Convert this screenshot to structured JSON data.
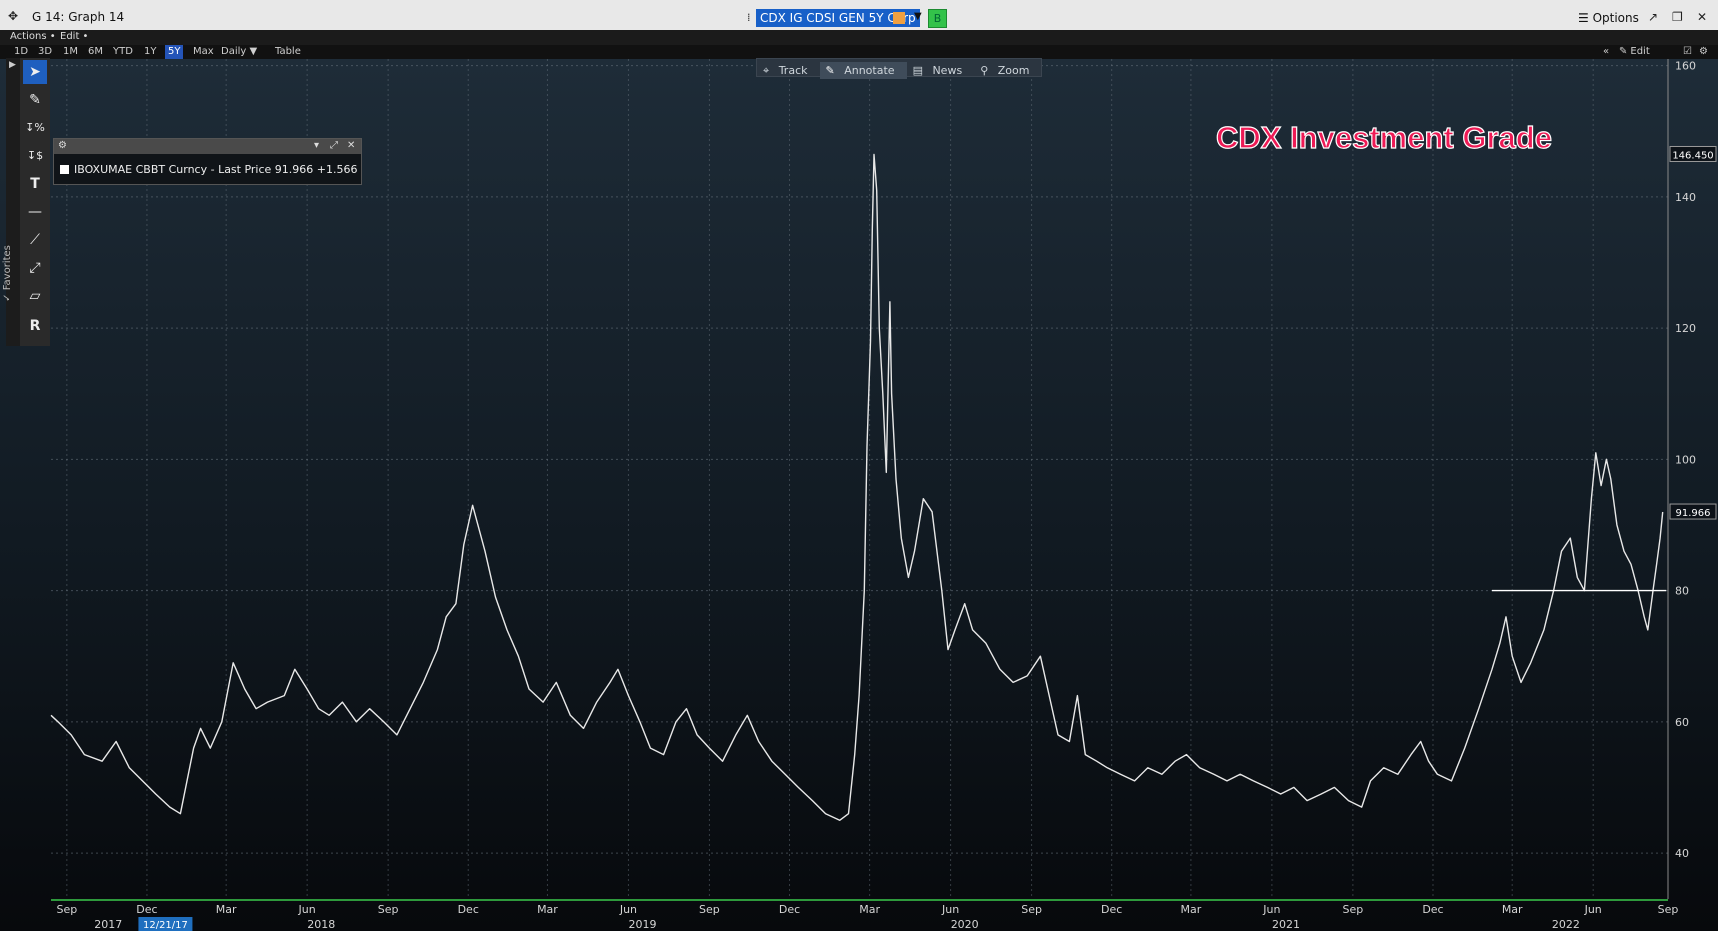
{
  "window": {
    "title": "G 14: Graph 14",
    "ticker": "CDX IG CDSI GEN 5Y Corp",
    "b_label": "B",
    "options_label": "Options",
    "icons": [
      "move-icon",
      "ticker-dropdown-icon",
      "popout-icon",
      "restore-icon",
      "close-icon"
    ]
  },
  "menu": {
    "actions": "Actions •",
    "edit": "Edit •"
  },
  "ranges": {
    "items": [
      "1D",
      "3D",
      "1M",
      "6M",
      "YTD",
      "1Y",
      "5Y",
      "Max"
    ],
    "selected": "5Y",
    "frequency": "Daily ▼",
    "table": "Table",
    "edit_chart": "Edit Chart"
  },
  "controls": [
    "Track",
    "Annotate",
    "News",
    "Zoom"
  ],
  "active_control": "Annotate",
  "favorites_label": "Favorites",
  "tools": [
    "cursor-icon",
    "pencil-icon",
    "percent-icon",
    "dollar-icon",
    "text-icon",
    "horizontal-line-icon",
    "trend-line-icon",
    "ray-line-icon",
    "channel-icon",
    "r-icon"
  ],
  "legend": {
    "text": "IBOXUMAE CBBT Curncy - Last Price 91.966  +1.566"
  },
  "annotation": "CDX Investment Grade",
  "chart_data": {
    "type": "line",
    "title": "",
    "xlabel": "",
    "ylabel": "",
    "ylim": [
      33,
      161
    ],
    "yticks": [
      40,
      60,
      80,
      100,
      120,
      140,
      160
    ],
    "grid": true,
    "y_axis_side": "right",
    "current_value_label": "91.966",
    "high_value_label": "146.450",
    "crosshair_date_label": "12/21/17",
    "month_ticks": [
      "Sep",
      "Dec",
      "Mar",
      "Jun",
      "Sep",
      "Dec",
      "Mar",
      "Jun",
      "Sep",
      "Dec",
      "Mar",
      "Jun",
      "Sep",
      "Dec",
      "Mar",
      "Jun",
      "Sep",
      "Dec",
      "Mar",
      "Jun",
      "Sep"
    ],
    "year_labels": [
      "2017",
      "2018",
      "2019",
      "2020",
      "2021",
      "2022"
    ],
    "horizontal_line": {
      "value": 80,
      "from": "2022-02",
      "to": "2022-09"
    },
    "series": [
      {
        "color": "#e8e8e8",
        "points": [
          [
            "2017-08-28",
            61
          ],
          [
            "2017-09-05",
            60
          ],
          [
            "2017-09-20",
            58
          ],
          [
            "2017-10-05",
            55
          ],
          [
            "2017-10-25",
            54
          ],
          [
            "2017-11-10",
            57
          ],
          [
            "2017-11-25",
            53
          ],
          [
            "2017-12-10",
            51
          ],
          [
            "2017-12-25",
            49
          ],
          [
            "2018-01-10",
            47
          ],
          [
            "2018-01-22",
            46
          ],
          [
            "2018-02-06",
            56
          ],
          [
            "2018-02-14",
            59
          ],
          [
            "2018-02-25",
            56
          ],
          [
            "2018-03-10",
            60
          ],
          [
            "2018-03-23",
            69
          ],
          [
            "2018-04-05",
            65
          ],
          [
            "2018-04-18",
            62
          ],
          [
            "2018-05-01",
            63
          ],
          [
            "2018-05-20",
            64
          ],
          [
            "2018-06-01",
            68
          ],
          [
            "2018-06-15",
            65
          ],
          [
            "2018-06-28",
            62
          ],
          [
            "2018-07-10",
            61
          ],
          [
            "2018-07-25",
            63
          ],
          [
            "2018-08-10",
            60
          ],
          [
            "2018-08-25",
            62
          ],
          [
            "2018-09-10",
            60
          ],
          [
            "2018-09-25",
            58
          ],
          [
            "2018-10-10",
            62
          ],
          [
            "2018-10-25",
            66
          ],
          [
            "2018-11-10",
            71
          ],
          [
            "2018-11-20",
            76
          ],
          [
            "2018-12-01",
            78
          ],
          [
            "2018-12-10",
            87
          ],
          [
            "2018-12-20",
            93
          ],
          [
            "2019-01-03",
            86
          ],
          [
            "2019-01-15",
            79
          ],
          [
            "2019-01-28",
            74
          ],
          [
            "2019-02-10",
            70
          ],
          [
            "2019-02-22",
            65
          ],
          [
            "2019-03-10",
            63
          ],
          [
            "2019-03-25",
            66
          ],
          [
            "2019-04-10",
            61
          ],
          [
            "2019-04-25",
            59
          ],
          [
            "2019-05-10",
            63
          ],
          [
            "2019-05-25",
            66
          ],
          [
            "2019-06-03",
            68
          ],
          [
            "2019-06-15",
            64
          ],
          [
            "2019-06-28",
            60
          ],
          [
            "2019-07-10",
            56
          ],
          [
            "2019-07-25",
            55
          ],
          [
            "2019-08-08",
            60
          ],
          [
            "2019-08-20",
            62
          ],
          [
            "2019-09-01",
            58
          ],
          [
            "2019-09-15",
            56
          ],
          [
            "2019-09-30",
            54
          ],
          [
            "2019-10-15",
            58
          ],
          [
            "2019-10-28",
            61
          ],
          [
            "2019-11-10",
            57
          ],
          [
            "2019-11-25",
            54
          ],
          [
            "2019-12-10",
            52
          ],
          [
            "2019-12-25",
            50
          ],
          [
            "2020-01-10",
            48
          ],
          [
            "2020-01-25",
            46
          ],
          [
            "2020-02-10",
            45
          ],
          [
            "2020-02-20",
            46
          ],
          [
            "2020-02-27",
            55
          ],
          [
            "2020-03-03",
            64
          ],
          [
            "2020-03-09",
            80
          ],
          [
            "2020-03-12",
            102
          ],
          [
            "2020-03-16",
            118
          ],
          [
            "2020-03-18",
            135
          ],
          [
            "2020-03-20",
            146.45
          ],
          [
            "2020-03-23",
            141
          ],
          [
            "2020-03-26",
            120
          ],
          [
            "2020-03-30",
            110
          ],
          [
            "2020-04-03",
            98
          ],
          [
            "2020-04-07",
            124
          ],
          [
            "2020-04-09",
            110
          ],
          [
            "2020-04-14",
            97
          ],
          [
            "2020-04-20",
            88
          ],
          [
            "2020-04-28",
            82
          ],
          [
            "2020-05-05",
            86
          ],
          [
            "2020-05-15",
            94
          ],
          [
            "2020-05-25",
            92
          ],
          [
            "2020-06-05",
            80
          ],
          [
            "2020-06-12",
            71
          ],
          [
            "2020-06-20",
            74
          ],
          [
            "2020-07-01",
            78
          ],
          [
            "2020-07-10",
            74
          ],
          [
            "2020-07-25",
            72
          ],
          [
            "2020-08-10",
            68
          ],
          [
            "2020-08-25",
            66
          ],
          [
            "2020-09-10",
            67
          ],
          [
            "2020-09-25",
            70
          ],
          [
            "2020-10-05",
            64
          ],
          [
            "2020-10-15",
            58
          ],
          [
            "2020-10-28",
            57
          ],
          [
            "2020-11-06",
            64
          ],
          [
            "2020-11-15",
            55
          ],
          [
            "2020-11-28",
            54
          ],
          [
            "2020-12-10",
            53
          ],
          [
            "2020-12-25",
            52
          ],
          [
            "2021-01-10",
            51
          ],
          [
            "2021-01-25",
            53
          ],
          [
            "2021-02-10",
            52
          ],
          [
            "2021-02-25",
            54
          ],
          [
            "2021-03-10",
            55
          ],
          [
            "2021-03-25",
            53
          ],
          [
            "2021-04-10",
            52
          ],
          [
            "2021-04-25",
            51
          ],
          [
            "2021-05-10",
            52
          ],
          [
            "2021-05-25",
            51
          ],
          [
            "2021-06-10",
            50
          ],
          [
            "2021-06-25",
            49
          ],
          [
            "2021-07-10",
            50
          ],
          [
            "2021-07-25",
            48
          ],
          [
            "2021-08-10",
            49
          ],
          [
            "2021-08-25",
            50
          ],
          [
            "2021-09-10",
            48
          ],
          [
            "2021-09-25",
            47
          ],
          [
            "2021-10-05",
            51
          ],
          [
            "2021-10-20",
            53
          ],
          [
            "2021-11-05",
            52
          ],
          [
            "2021-11-20",
            55
          ],
          [
            "2021-12-01",
            57
          ],
          [
            "2021-12-10",
            54
          ],
          [
            "2021-12-20",
            52
          ],
          [
            "2022-01-05",
            51
          ],
          [
            "2022-01-20",
            56
          ],
          [
            "2022-02-05",
            62
          ],
          [
            "2022-02-20",
            68
          ],
          [
            "2022-03-01",
            72
          ],
          [
            "2022-03-08",
            76
          ],
          [
            "2022-03-15",
            70
          ],
          [
            "2022-03-25",
            66
          ],
          [
            "2022-04-05",
            69
          ],
          [
            "2022-04-20",
            74
          ],
          [
            "2022-05-01",
            80
          ],
          [
            "2022-05-10",
            86
          ],
          [
            "2022-05-20",
            88
          ],
          [
            "2022-05-28",
            82
          ],
          [
            "2022-06-05",
            80
          ],
          [
            "2022-06-13",
            94
          ],
          [
            "2022-06-18",
            101
          ],
          [
            "2022-06-24",
            96
          ],
          [
            "2022-06-30",
            100
          ],
          [
            "2022-07-05",
            97
          ],
          [
            "2022-07-12",
            90
          ],
          [
            "2022-07-20",
            86
          ],
          [
            "2022-07-28",
            84
          ],
          [
            "2022-08-05",
            80
          ],
          [
            "2022-08-12",
            76
          ],
          [
            "2022-08-16",
            74
          ],
          [
            "2022-08-22",
            80
          ],
          [
            "2022-08-26",
            84
          ],
          [
            "2022-08-30",
            88
          ],
          [
            "2022-09-02",
            91.966
          ]
        ]
      }
    ]
  }
}
